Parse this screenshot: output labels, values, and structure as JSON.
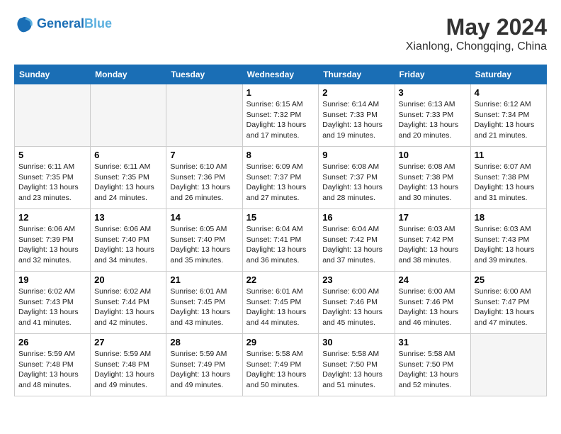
{
  "header": {
    "logo_line1": "General",
    "logo_line2": "Blue",
    "month_year": "May 2024",
    "location": "Xianlong, Chongqing, China"
  },
  "weekdays": [
    "Sunday",
    "Monday",
    "Tuesday",
    "Wednesday",
    "Thursday",
    "Friday",
    "Saturday"
  ],
  "weeks": [
    [
      {
        "day": "",
        "sunrise": "",
        "sunset": "",
        "daylight": ""
      },
      {
        "day": "",
        "sunrise": "",
        "sunset": "",
        "daylight": ""
      },
      {
        "day": "",
        "sunrise": "",
        "sunset": "",
        "daylight": ""
      },
      {
        "day": "1",
        "sunrise": "Sunrise: 6:15 AM",
        "sunset": "Sunset: 7:32 PM",
        "daylight": "Daylight: 13 hours and 17 minutes."
      },
      {
        "day": "2",
        "sunrise": "Sunrise: 6:14 AM",
        "sunset": "Sunset: 7:33 PM",
        "daylight": "Daylight: 13 hours and 19 minutes."
      },
      {
        "day": "3",
        "sunrise": "Sunrise: 6:13 AM",
        "sunset": "Sunset: 7:33 PM",
        "daylight": "Daylight: 13 hours and 20 minutes."
      },
      {
        "day": "4",
        "sunrise": "Sunrise: 6:12 AM",
        "sunset": "Sunset: 7:34 PM",
        "daylight": "Daylight: 13 hours and 21 minutes."
      }
    ],
    [
      {
        "day": "5",
        "sunrise": "Sunrise: 6:11 AM",
        "sunset": "Sunset: 7:35 PM",
        "daylight": "Daylight: 13 hours and 23 minutes."
      },
      {
        "day": "6",
        "sunrise": "Sunrise: 6:11 AM",
        "sunset": "Sunset: 7:35 PM",
        "daylight": "Daylight: 13 hours and 24 minutes."
      },
      {
        "day": "7",
        "sunrise": "Sunrise: 6:10 AM",
        "sunset": "Sunset: 7:36 PM",
        "daylight": "Daylight: 13 hours and 26 minutes."
      },
      {
        "day": "8",
        "sunrise": "Sunrise: 6:09 AM",
        "sunset": "Sunset: 7:37 PM",
        "daylight": "Daylight: 13 hours and 27 minutes."
      },
      {
        "day": "9",
        "sunrise": "Sunrise: 6:08 AM",
        "sunset": "Sunset: 7:37 PM",
        "daylight": "Daylight: 13 hours and 28 minutes."
      },
      {
        "day": "10",
        "sunrise": "Sunrise: 6:08 AM",
        "sunset": "Sunset: 7:38 PM",
        "daylight": "Daylight: 13 hours and 30 minutes."
      },
      {
        "day": "11",
        "sunrise": "Sunrise: 6:07 AM",
        "sunset": "Sunset: 7:38 PM",
        "daylight": "Daylight: 13 hours and 31 minutes."
      }
    ],
    [
      {
        "day": "12",
        "sunrise": "Sunrise: 6:06 AM",
        "sunset": "Sunset: 7:39 PM",
        "daylight": "Daylight: 13 hours and 32 minutes."
      },
      {
        "day": "13",
        "sunrise": "Sunrise: 6:06 AM",
        "sunset": "Sunset: 7:40 PM",
        "daylight": "Daylight: 13 hours and 34 minutes."
      },
      {
        "day": "14",
        "sunrise": "Sunrise: 6:05 AM",
        "sunset": "Sunset: 7:40 PM",
        "daylight": "Daylight: 13 hours and 35 minutes."
      },
      {
        "day": "15",
        "sunrise": "Sunrise: 6:04 AM",
        "sunset": "Sunset: 7:41 PM",
        "daylight": "Daylight: 13 hours and 36 minutes."
      },
      {
        "day": "16",
        "sunrise": "Sunrise: 6:04 AM",
        "sunset": "Sunset: 7:42 PM",
        "daylight": "Daylight: 13 hours and 37 minutes."
      },
      {
        "day": "17",
        "sunrise": "Sunrise: 6:03 AM",
        "sunset": "Sunset: 7:42 PM",
        "daylight": "Daylight: 13 hours and 38 minutes."
      },
      {
        "day": "18",
        "sunrise": "Sunrise: 6:03 AM",
        "sunset": "Sunset: 7:43 PM",
        "daylight": "Daylight: 13 hours and 39 minutes."
      }
    ],
    [
      {
        "day": "19",
        "sunrise": "Sunrise: 6:02 AM",
        "sunset": "Sunset: 7:43 PM",
        "daylight": "Daylight: 13 hours and 41 minutes."
      },
      {
        "day": "20",
        "sunrise": "Sunrise: 6:02 AM",
        "sunset": "Sunset: 7:44 PM",
        "daylight": "Daylight: 13 hours and 42 minutes."
      },
      {
        "day": "21",
        "sunrise": "Sunrise: 6:01 AM",
        "sunset": "Sunset: 7:45 PM",
        "daylight": "Daylight: 13 hours and 43 minutes."
      },
      {
        "day": "22",
        "sunrise": "Sunrise: 6:01 AM",
        "sunset": "Sunset: 7:45 PM",
        "daylight": "Daylight: 13 hours and 44 minutes."
      },
      {
        "day": "23",
        "sunrise": "Sunrise: 6:00 AM",
        "sunset": "Sunset: 7:46 PM",
        "daylight": "Daylight: 13 hours and 45 minutes."
      },
      {
        "day": "24",
        "sunrise": "Sunrise: 6:00 AM",
        "sunset": "Sunset: 7:46 PM",
        "daylight": "Daylight: 13 hours and 46 minutes."
      },
      {
        "day": "25",
        "sunrise": "Sunrise: 6:00 AM",
        "sunset": "Sunset: 7:47 PM",
        "daylight": "Daylight: 13 hours and 47 minutes."
      }
    ],
    [
      {
        "day": "26",
        "sunrise": "Sunrise: 5:59 AM",
        "sunset": "Sunset: 7:48 PM",
        "daylight": "Daylight: 13 hours and 48 minutes."
      },
      {
        "day": "27",
        "sunrise": "Sunrise: 5:59 AM",
        "sunset": "Sunset: 7:48 PM",
        "daylight": "Daylight: 13 hours and 49 minutes."
      },
      {
        "day": "28",
        "sunrise": "Sunrise: 5:59 AM",
        "sunset": "Sunset: 7:49 PM",
        "daylight": "Daylight: 13 hours and 49 minutes."
      },
      {
        "day": "29",
        "sunrise": "Sunrise: 5:58 AM",
        "sunset": "Sunset: 7:49 PM",
        "daylight": "Daylight: 13 hours and 50 minutes."
      },
      {
        "day": "30",
        "sunrise": "Sunrise: 5:58 AM",
        "sunset": "Sunset: 7:50 PM",
        "daylight": "Daylight: 13 hours and 51 minutes."
      },
      {
        "day": "31",
        "sunrise": "Sunrise: 5:58 AM",
        "sunset": "Sunset: 7:50 PM",
        "daylight": "Daylight: 13 hours and 52 minutes."
      },
      {
        "day": "",
        "sunrise": "",
        "sunset": "",
        "daylight": ""
      }
    ]
  ]
}
